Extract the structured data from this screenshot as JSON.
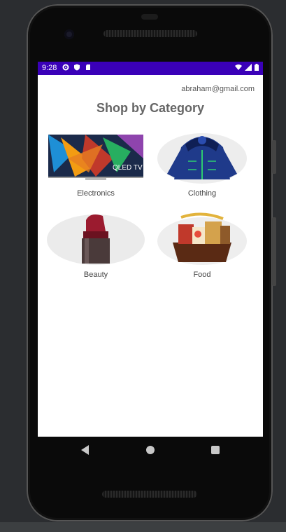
{
  "status_bar": {
    "time": "9:28",
    "left_icons": [
      "gear-icon",
      "shield-icon",
      "sd-card-icon"
    ],
    "right_icons": [
      "wifi-icon",
      "signal-icon",
      "battery-icon"
    ],
    "color": "#3a00b8"
  },
  "header": {
    "email": "abraham@gmail.com",
    "title": "Shop by Category"
  },
  "categories": [
    {
      "label": "Electronics",
      "image": "qled-tv-image"
    },
    {
      "label": "Clothing",
      "image": "winter-jacket-image"
    },
    {
      "label": "Beauty",
      "image": "lipstick-image"
    },
    {
      "label": "Food",
      "image": "gift-basket-image"
    }
  ],
  "nav_bar": {
    "buttons": [
      "back-icon",
      "home-icon",
      "recents-icon"
    ]
  },
  "tv_overlay_text": "QLED TV"
}
